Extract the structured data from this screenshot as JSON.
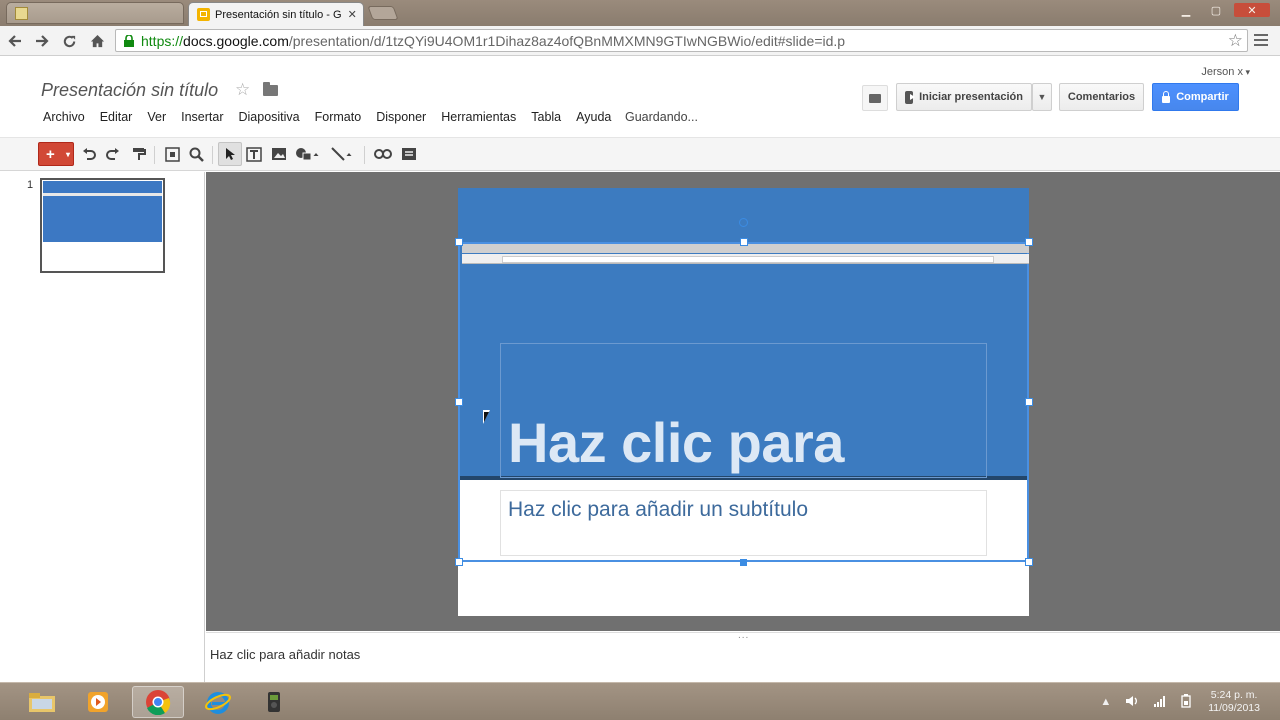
{
  "browser": {
    "tabs": [
      {
        "label": "",
        "active": false
      },
      {
        "label": "Presentación sin título - G",
        "active": true
      },
      {
        "label": "",
        "active": false
      }
    ],
    "tab_close": "✕",
    "url_scheme": "https://",
    "url_host": "docs.google.com",
    "url_path": "/presentation/d/1tzQYi9U4OM1r1Dihaz8az4ofQBnMMXMN9GTIwNGBWio/edit#slide=id.p",
    "window_controls": {
      "minimize": "▁",
      "maximize": "▢",
      "close": "✕"
    }
  },
  "docs": {
    "title": "Presentación sin título",
    "user": "Jerson x",
    "menu": [
      "Archivo",
      "Editar",
      "Ver",
      "Insertar",
      "Diapositiva",
      "Formato",
      "Disponer",
      "Herramientas",
      "Tabla",
      "Ayuda"
    ],
    "status": "Guardando...",
    "present_label": "Iniciar presentación",
    "comments_label": "Comentarios",
    "share_label": "Compartir"
  },
  "toolbar": {
    "new_label": "+",
    "icons": [
      "undo-icon",
      "redo-icon",
      "paint-format-icon",
      "zoom-fit-icon",
      "zoom-icon",
      "select-icon",
      "textbox-icon",
      "image-icon",
      "shape-icon",
      "line-icon",
      "link-icon",
      "comment-icon"
    ]
  },
  "filmstrip": {
    "slides": [
      {
        "number": "1"
      }
    ]
  },
  "slide": {
    "title": "Haz clic para",
    "subtitle": "Haz clic para añadir un subtítulo"
  },
  "notes": {
    "placeholder": "Haz clic para añadir notas",
    "grip": "..."
  },
  "taskbar": {
    "apps": [
      "explorer-icon",
      "media-player-icon",
      "chrome-icon",
      "internet-explorer-icon",
      "camera-app-icon"
    ],
    "active_app": "chrome-icon",
    "time": "5:24 p. m.",
    "date": "11/09/2013"
  },
  "colors": {
    "slide_blue": "#3c7bc0",
    "share_blue": "#4d90fe",
    "new_button_red": "#d14836",
    "selection_blue": "#3b8ce3"
  }
}
